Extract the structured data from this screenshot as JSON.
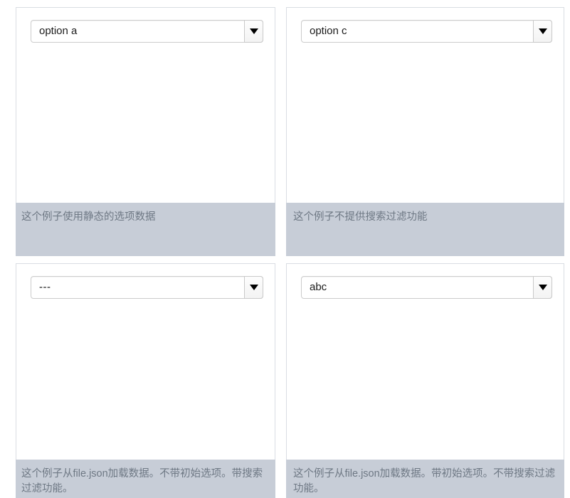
{
  "examples": [
    {
      "id": "static-options",
      "selected_value": "option a",
      "caption": "这个例子使用静态的选项数据",
      "arrow_icon": "chevron-down-icon"
    },
    {
      "id": "no-search-filter",
      "selected_value": "option c",
      "caption": "这个例子不提供搜索过滤功能",
      "arrow_icon": "chevron-down-icon"
    },
    {
      "id": "remote-no-initial-with-search",
      "selected_value": "---",
      "caption": "这个例子从file.json加载数据。不带初始选项。带搜索过滤功能。",
      "arrow_icon": "chevron-down-icon"
    },
    {
      "id": "remote-with-initial-no-search",
      "selected_value": "abc",
      "caption": "这个例子从file.json加载数据。带初始选项。不带搜索过滤功能。",
      "arrow_icon": "chevron-down-icon"
    }
  ],
  "colors": {
    "cell_background": "#c7cdd7",
    "panel_background": "#ffffff",
    "caption_text": "#6e7884",
    "select_border": "#cccccc",
    "caret": "#000000"
  }
}
